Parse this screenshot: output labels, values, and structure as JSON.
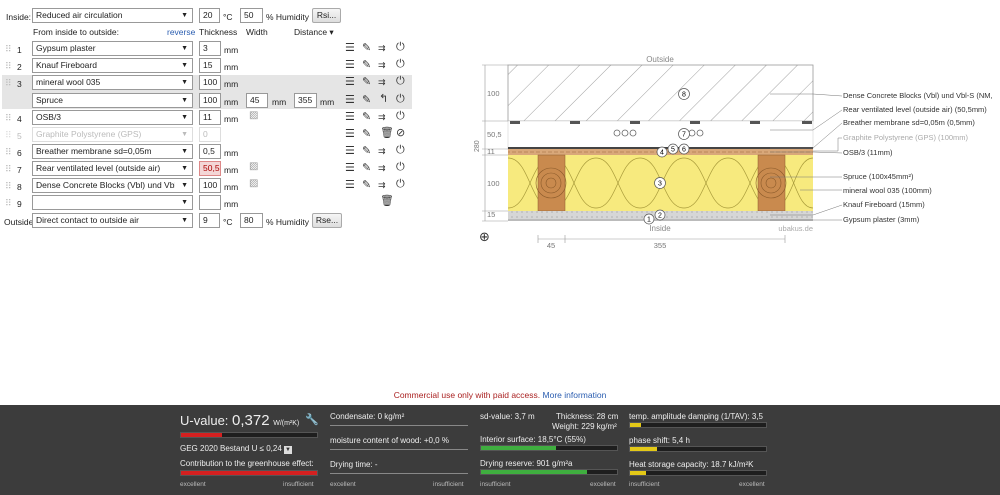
{
  "inside": {
    "label": "Inside:",
    "climate": "Reduced air circulation",
    "temperature": "20",
    "temp_unit": "°C",
    "humidity": "50",
    "humidity_unit": "% Humidity",
    "rsi_button": "Rsi..."
  },
  "table_header": {
    "from_to": "From inside to outside:",
    "reverse": "reverse",
    "thickness": "Thickness",
    "width": "Width",
    "distance": "Distance ▾"
  },
  "layers": [
    {
      "num": "1",
      "material": "Gypsum plaster",
      "thickness": "3",
      "unit": "mm"
    },
    {
      "num": "2",
      "material": "Knauf Fireboard",
      "thickness": "15",
      "unit": "mm"
    },
    {
      "num": "3",
      "material": "mineral wool 035",
      "thickness": "100",
      "unit": "mm",
      "sub_material": "Spruce",
      "sub_thickness": "100",
      "width": "45",
      "distance": "355"
    },
    {
      "num": "4",
      "material": "OSB/3",
      "thickness": "11",
      "unit": "mm"
    },
    {
      "num": "5",
      "material": "Graphite Polystyrene (GPS)",
      "thickness": "0",
      "unit": "mm"
    },
    {
      "num": "6",
      "material": "Breather membrane sd=0,05m",
      "thickness": "0,5",
      "unit": "mm"
    },
    {
      "num": "7",
      "material": "Rear ventilated level (outside air)",
      "thickness": "50,5",
      "unit": "mm"
    },
    {
      "num": "8",
      "material": "Dense Concrete Blocks (Vbl) und Vbl-",
      "thickness": "100",
      "unit": "mm"
    },
    {
      "num": "9",
      "material": "",
      "thickness": "",
      "unit": "mm"
    }
  ],
  "outside": {
    "label": "Outside",
    "climate": "Direct contact to outside air",
    "temperature": "9",
    "temp_unit": "°C",
    "humidity": "80",
    "humidity_unit": "% Humidity",
    "rse_button": "Rse..."
  },
  "diagram": {
    "outside_label": "Outside",
    "inside_label": "Inside",
    "watermark": "ubakus.de",
    "left_dims": [
      "100",
      "50,5",
      "11",
      "100",
      "15"
    ],
    "total_dim": "280",
    "bottom_dims": [
      "45",
      "355"
    ],
    "legend": [
      "Dense Concrete Blocks (Vbl) und Vbl-S (NM,",
      "Rear ventilated level (outside air) (50,5mm)",
      "Breather membrane sd=0,05m (0,5mm)",
      "Graphite Polystyrene (GPS) (100mm)",
      "OSB/3 (11mm)",
      "Spruce (100x45mm²)",
      "mineral wool 035 (100mm)",
      "Knauf Fireboard (15mm)",
      "Gypsum plaster (3mm)"
    ],
    "markers": [
      "1",
      "2",
      "3",
      "4",
      "5",
      "6",
      "7",
      "8"
    ]
  },
  "notice": {
    "text": "Commercial use only with paid access.",
    "link": "More information"
  },
  "footer": {
    "u_label": "U-value:",
    "u_value": "0,372",
    "u_unit": "W/(m²K)",
    "u_fraction": 0.3,
    "geg": "GEG 2020 Bestand U ≤ 0,24",
    "greenhouse": "Contribution to the greenhouse effect:",
    "greenhouse_fraction": 1.0,
    "condensate": "Condensate: 0 kg/m²",
    "moisture": "moisture content of wood: +0,0 %",
    "drying_time": "Drying time: -",
    "sd_value": "sd-value: 3,7 m",
    "thickness": "Thickness: 28 cm",
    "weight": "Weight: 229 kg/m²",
    "interior_surface": "Interior surface: 18,5°C (55%)",
    "interior_fraction": 0.55,
    "drying_reserve": "Drying reserve: 901 g/m²a",
    "drying_reserve_fraction": 0.78,
    "temp_amplitude": "temp. amplitude damping (1/TAV): 3,5",
    "temp_amplitude_fraction": 0.08,
    "phase_shift": "phase shift: 5,4 h",
    "phase_shift_fraction": 0.2,
    "heat_storage": "Heat storage capacity: 18.7 kJ/m²K",
    "heat_storage_fraction": 0.12,
    "excellent": "excellent",
    "insufficient": "insufficient"
  }
}
